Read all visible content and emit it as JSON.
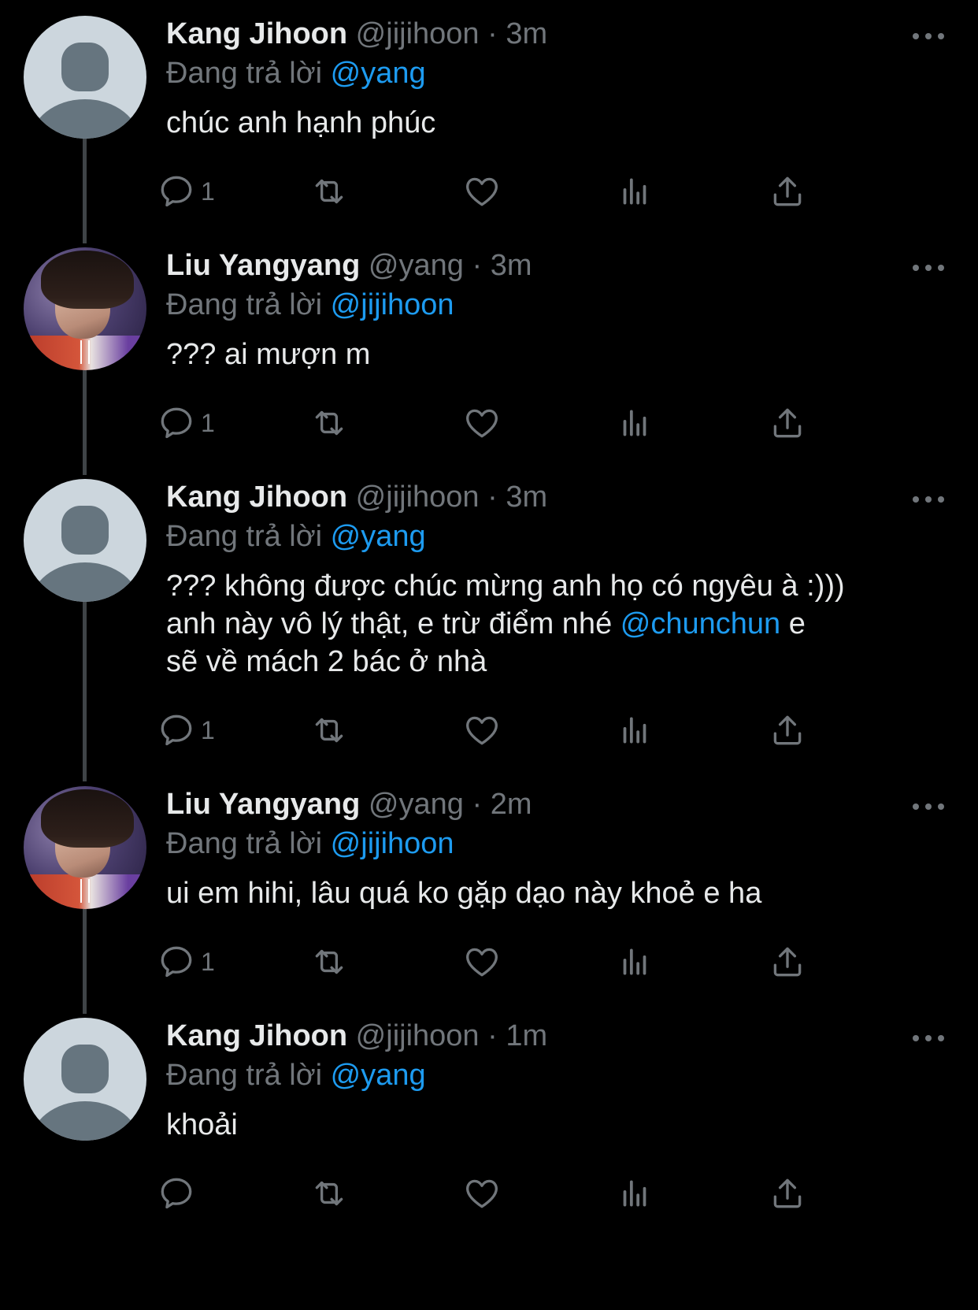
{
  "colors": {
    "background": "#000000",
    "primary_text": "#e7e9ea",
    "secondary_text": "#71767b",
    "mention": "#1d9bf0",
    "connector": "#3f4447"
  },
  "reply_prefix": "Đang trả lời",
  "tweets": [
    {
      "name": "Kang Jihoon",
      "handle": "@jijihoon",
      "separator": "·",
      "time": "3m",
      "reply_to": "@yang",
      "text_parts": [
        "chúc anh hạnh phúc"
      ],
      "reply_count": "1",
      "avatar": "default-avatar"
    },
    {
      "name": "Liu Yangyang",
      "handle": "@yang",
      "separator": "·",
      "time": "3m",
      "reply_to": "@jijihoon",
      "text_parts": [
        "??? ai mượn m"
      ],
      "reply_count": "1",
      "avatar": "profile-photo"
    },
    {
      "name": "Kang Jihoon",
      "handle": "@jijihoon",
      "separator": "·",
      "time": "3m",
      "reply_to": "@yang",
      "text_parts": [
        "??? không được chúc mừng anh họ có ngyêu à :)))",
        "anh này vô lý thật, e trừ điểm nhé ",
        "@chunchun",
        " e",
        "sẽ về mách 2 bác ở nhà"
      ],
      "reply_count": "1",
      "avatar": "default-avatar"
    },
    {
      "name": "Liu Yangyang",
      "handle": "@yang",
      "separator": "·",
      "time": "2m",
      "reply_to": "@jijihoon",
      "text_parts": [
        "ui em hihi, lâu quá ko gặp dạo này khoẻ e ha"
      ],
      "reply_count": "1",
      "avatar": "profile-photo"
    },
    {
      "name": "Kang Jihoon",
      "handle": "@jijihoon",
      "separator": "·",
      "time": "1m",
      "reply_to": "@yang",
      "text_parts": [
        "khoải"
      ],
      "reply_count": "",
      "avatar": "default-avatar"
    }
  ],
  "icons": {
    "reply": "reply-icon",
    "retweet": "retweet-icon",
    "like": "heart-icon",
    "views": "analytics-icon",
    "share": "share-icon",
    "more": "more-icon"
  }
}
